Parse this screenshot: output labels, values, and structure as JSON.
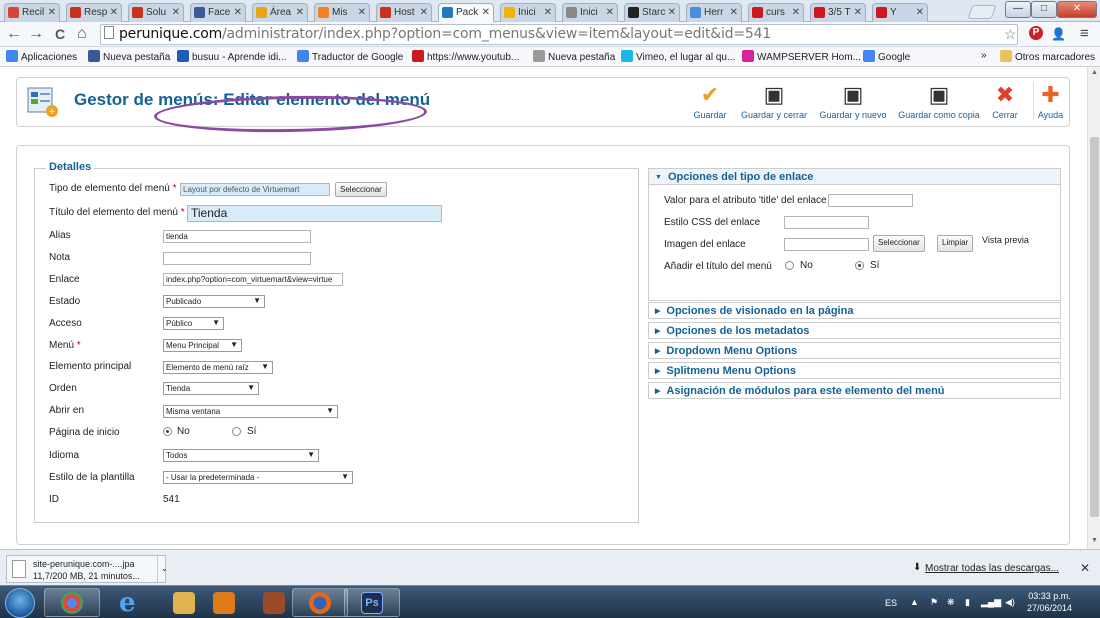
{
  "tabs": [
    {
      "label": "Recil",
      "color": "#d44638"
    },
    {
      "label": "Resp",
      "color": "#c9311d"
    },
    {
      "label": "Solu",
      "color": "#c9311d"
    },
    {
      "label": "Face",
      "color": "#3b5998"
    },
    {
      "label": "Área",
      "color": "#e8a317"
    },
    {
      "label": "Mis",
      "color": "#f48120"
    },
    {
      "label": "Host",
      "color": "#c9311d"
    },
    {
      "label": "Pack",
      "color": "#1a7bc1"
    },
    {
      "label": "Inici",
      "color": "#f0b400"
    },
    {
      "label": "Inici",
      "color": "#888888"
    },
    {
      "label": "Starc",
      "color": "#222222"
    },
    {
      "label": "Herr",
      "color": "#4a90d9"
    },
    {
      "label": "curs",
      "color": "#cc181e"
    },
    {
      "label": "3/5 T",
      "color": "#cc181e"
    },
    {
      "label": "Y",
      "color": "#cc181e"
    }
  ],
  "window": {
    "minimize": "—",
    "maximize": "□",
    "close": "✕"
  },
  "addressbar": {
    "back": "←",
    "forward": "→",
    "reload": "C",
    "home": "⌂",
    "url_host": "perunique.com",
    "url_path": "/administrator/index.php?option=com_menus&view=item&layout=edit&id=541",
    "star": "☆",
    "pinterest": "P",
    "user": "👤",
    "menu": "≡"
  },
  "bookmarks": [
    {
      "label": "Aplicaciones",
      "icon": "apps-icon",
      "color": "#4285f4"
    },
    {
      "label": "Nueva pestaña",
      "icon": "facebook-icon",
      "color": "#3b5998"
    },
    {
      "label": "busuu - Aprende idi...",
      "icon": "busuu-icon",
      "color": "#1f5eb5"
    },
    {
      "label": "Traductor de Google",
      "icon": "translate-icon",
      "color": "#4285f4"
    },
    {
      "label": "https://www.youtub...",
      "icon": "youtube-icon",
      "color": "#cc181e"
    },
    {
      "label": "Nueva pestaña",
      "icon": "page-icon",
      "color": "#999999"
    },
    {
      "label": "Vimeo, el lugar al qu...",
      "icon": "vimeo-icon",
      "color": "#1ab7ea"
    },
    {
      "label": "WAMPSERVER Hom...",
      "icon": "wamp-icon",
      "color": "#d6249f"
    },
    {
      "label": "Google",
      "icon": "google-icon",
      "color": "#4285f4"
    }
  ],
  "bookmarks_more": "»",
  "bookmarks_other": "Otros marcadores",
  "header": {
    "title": "Gestor de menús: Editar elemento del menú",
    "toolbar": [
      {
        "label": "Guardar",
        "icon": "check-icon",
        "glyph": "✔",
        "color": "#f0a020"
      },
      {
        "label": "Guardar y cerrar",
        "icon": "save-close-icon",
        "glyph": "▣",
        "color": "#444444"
      },
      {
        "label": "Guardar y nuevo",
        "icon": "save-new-icon",
        "glyph": "▣",
        "color": "#444444"
      },
      {
        "label": "Guardar como copia",
        "icon": "save-copy-icon",
        "glyph": "▣",
        "color": "#444444"
      },
      {
        "label": "Cerrar",
        "icon": "cancel-icon",
        "glyph": "✖",
        "color": "#e0402a"
      },
      {
        "label": "Ayuda",
        "icon": "help-icon",
        "glyph": "✚",
        "color": "#e8622a"
      }
    ]
  },
  "details": {
    "legend": "Detalles",
    "fields": {
      "tipo_label": "Tipo de elemento del menú",
      "tipo_value": "Layout por defecto de Virtuemart",
      "tipo_button": "Seleccionar",
      "titulo_label": "Título del elemento del menú",
      "titulo_value": "Tienda",
      "alias_label": "Alias",
      "alias_value": "tienda",
      "nota_label": "Nota",
      "nota_value": "",
      "enlace_label": "Enlace",
      "enlace_value": "index.php?option=com_virtuemart&view=virtue",
      "estado_label": "Estado",
      "estado_value": "Publicado",
      "acceso_label": "Acceso",
      "acceso_value": "Público",
      "menu_label": "Menú",
      "menu_value": "Menu Principal",
      "padre_label": "Elemento principal",
      "padre_value": "Elemento de menú raíz",
      "orden_label": "Orden",
      "orden_value": "Tienda",
      "abrir_label": "Abrir en",
      "abrir_value": "Misma ventana",
      "inicio_label": "Página de inicio",
      "inicio_no": "No",
      "inicio_si": "Sí",
      "idioma_label": "Idioma",
      "idioma_value": "Todos",
      "estilo_label": "Estilo de la plantilla",
      "estilo_value": "- Usar la predeterminada -",
      "id_label": "ID",
      "id_value": "541"
    },
    "required_mark": "*",
    "caret": "▼"
  },
  "link_options": {
    "title": "Opciones del tipo de enlace",
    "title_attr_label": "Valor para el atributo 'title' del enlace",
    "css_label": "Estilo CSS del enlace",
    "image_label": "Imagen del enlace",
    "image_select": "Seleccionar",
    "image_clear": "Limpiar",
    "preview": "Vista previa",
    "add_title_label": "Añadir el título del menú",
    "no": "No",
    "si": "Sí"
  },
  "collapsed_panels": [
    "Opciones de visionado en la página",
    "Opciones de los metadatos",
    "Dropdown Menu Options",
    "Splitmenu Menu Options",
    "Asignación de módulos para este elemento del menú"
  ],
  "download": {
    "filename": "site-perunique.com-....jpa",
    "progress": "11,7/200 MB, 21 minutos...",
    "show_all": "Mostrar todas las descargas...",
    "close": "✕"
  },
  "taskbar": {
    "lang": "ES",
    "time": "03:33 p.m.",
    "date": "27/06/2014",
    "apps": [
      {
        "name": "chrome",
        "color": "#3c9a3c"
      },
      {
        "name": "internet-explorer",
        "color": "#2f7fd6"
      },
      {
        "name": "file-explorer",
        "color": "#e0b450"
      },
      {
        "name": "media-player",
        "color": "#e07b1a"
      },
      {
        "name": "paint",
        "color": "#9b4a2a"
      },
      {
        "name": "firefox",
        "color": "#e2671b"
      },
      {
        "name": "photoshop",
        "color": "#1f2d4f"
      }
    ]
  }
}
